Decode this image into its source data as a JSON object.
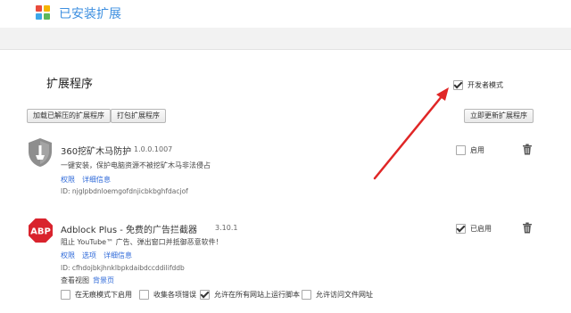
{
  "header": {
    "title": "已安装扩展"
  },
  "page": {
    "title": "扩展程序",
    "developer_mode": {
      "label": "开发者模式",
      "checked": true
    }
  },
  "toolbar": {
    "load_unpacked": "加载已解压的扩展程序",
    "pack": "打包扩展程序",
    "update_now": "立即更新扩展程序"
  },
  "extensions": [
    {
      "name": "360挖矿木马防护",
      "version": "1.0.0.1007",
      "description": "一键安装，保护电脑资源不被挖矿木马非法侵占",
      "links": [
        "权限",
        "详细信息"
      ],
      "id_text": "ID: njglpbdnloemgofdnjicbkbghfdacjof",
      "enable_label": "启用",
      "enabled": false
    },
    {
      "name": "Adblock Plus - 免费的广告拦截器",
      "version": "3.10.1",
      "description": "阻止 YouTube™ 广告、弹出窗口并抵御恶意软件！",
      "links": [
        "权限",
        "选项",
        "详细信息"
      ],
      "id_text": "ID: cfhdojbkjhnklbpkdaibdccddilifddb",
      "views_label": "查看视图",
      "views_link": "背景页",
      "enable_label": "已启用",
      "enabled": true,
      "options": [
        {
          "label": "在无痕模式下启用",
          "checked": false
        },
        {
          "label": "收集各项错误",
          "checked": false
        },
        {
          "label": "允许在所有网站上运行脚本",
          "checked": true
        },
        {
          "label": "允许访问文件网址",
          "checked": false
        }
      ]
    }
  ],
  "colors": {
    "accent": "#3d8fe0",
    "link": "#2f6ad9",
    "arrow": "#e02626",
    "abp_red": "#d9232d"
  }
}
